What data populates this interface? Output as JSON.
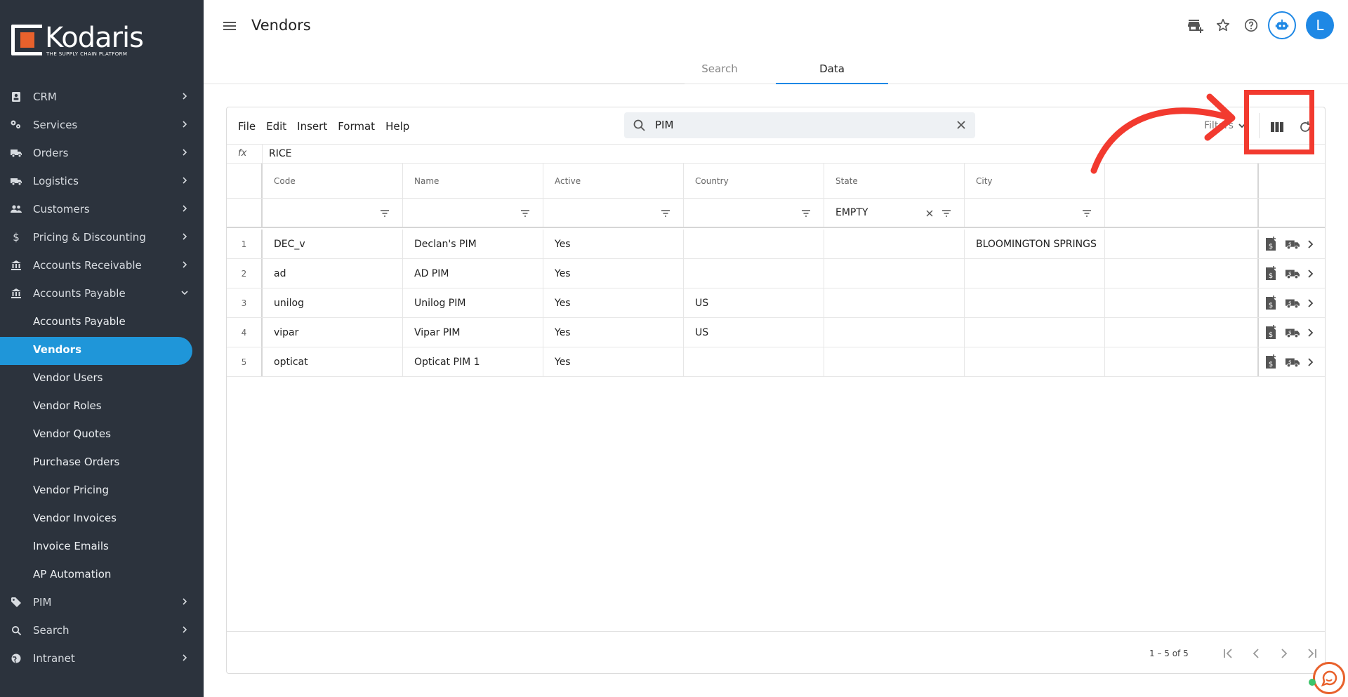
{
  "app": {
    "brand": "Kodaris",
    "tagline": "THE SUPPLY CHAIN PLATFORM",
    "page_title": "Vendors",
    "avatar_initial": "L",
    "accent_color": "#1e88e5",
    "sidebar_bg": "#2c333d",
    "active_nav_color": "#1f96d9",
    "annotation_color": "#f23a2f"
  },
  "sidebar": {
    "items": [
      {
        "label": "CRM",
        "icon": "contact-card-icon"
      },
      {
        "label": "Services",
        "icon": "services-icon"
      },
      {
        "label": "Orders",
        "icon": "truck-icon"
      },
      {
        "label": "Logistics",
        "icon": "shipping-icon"
      },
      {
        "label": "Customers",
        "icon": "people-icon"
      },
      {
        "label": "Pricing & Discounting",
        "icon": "dollar-icon"
      },
      {
        "label": "Accounts Receivable",
        "icon": "bank-icon"
      },
      {
        "label": "Accounts Payable",
        "icon": "bank-icon"
      }
    ],
    "sub_items": [
      {
        "label": "Accounts Payable"
      },
      {
        "label": "Vendors"
      },
      {
        "label": "Vendor Users"
      },
      {
        "label": "Vendor Roles"
      },
      {
        "label": "Vendor Quotes"
      },
      {
        "label": "Purchase Orders"
      },
      {
        "label": "Vendor Pricing"
      },
      {
        "label": "Vendor Invoices"
      },
      {
        "label": "Invoice Emails"
      },
      {
        "label": "AP Automation"
      }
    ],
    "bottom_items": [
      {
        "label": "PIM",
        "icon": "tag-icon"
      },
      {
        "label": "Search",
        "icon": "search-icon"
      },
      {
        "label": "Intranet",
        "icon": "intranet-icon"
      }
    ]
  },
  "tabs": [
    "Search",
    "Data"
  ],
  "toolbar": {
    "menu": [
      "File",
      "Edit",
      "Insert",
      "Format",
      "Help"
    ],
    "search_value": "PIM",
    "filters_label": "Filters"
  },
  "formula_bar": {
    "fx_label": "fx",
    "value": "RICE"
  },
  "table": {
    "columns": [
      "Code",
      "Name",
      "Active",
      "Country",
      "State",
      "City"
    ],
    "filters": {
      "state": "EMPTY"
    },
    "rows": [
      {
        "num": "1",
        "code": "DEC_v",
        "name": "Declan's PIM",
        "active": "Yes",
        "country": "",
        "state": "",
        "city": "BLOOMINGTON SPRINGS"
      },
      {
        "num": "2",
        "code": "ad",
        "name": "AD PIM",
        "active": "Yes",
        "country": "",
        "state": "",
        "city": ""
      },
      {
        "num": "3",
        "code": "unilog",
        "name": "Unilog PIM",
        "active": "Yes",
        "country": "US",
        "state": "",
        "city": ""
      },
      {
        "num": "4",
        "code": "vipar",
        "name": "Vipar PIM",
        "active": "Yes",
        "country": "US",
        "state": "",
        "city": ""
      },
      {
        "num": "5",
        "code": "opticat",
        "name": "Opticat PIM 1",
        "active": "Yes",
        "country": "",
        "state": "",
        "city": ""
      }
    ]
  },
  "pagination": {
    "range": "1 – 5 of 5"
  }
}
